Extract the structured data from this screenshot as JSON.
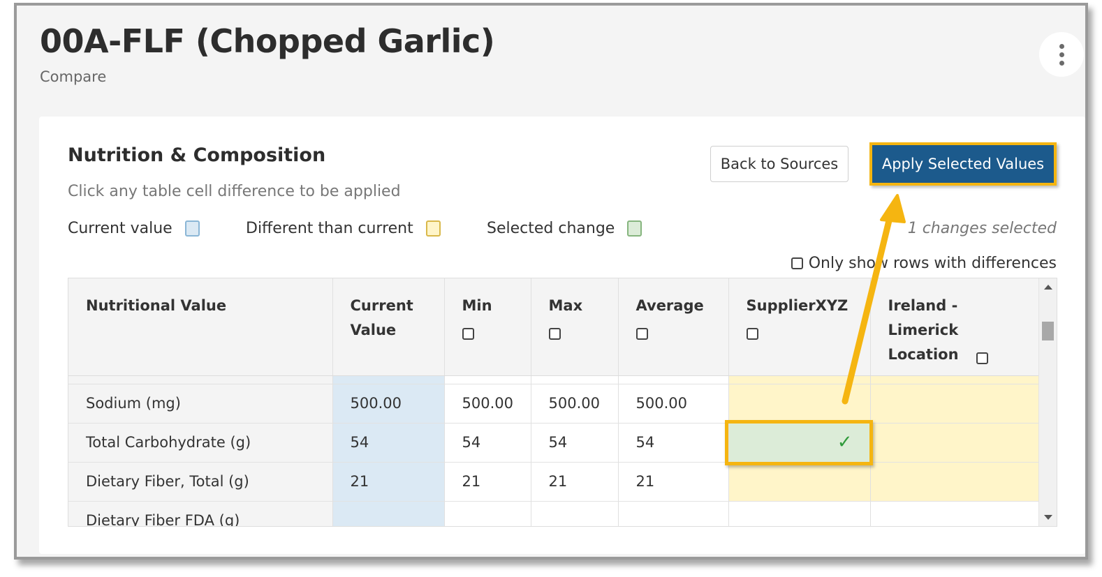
{
  "header": {
    "title": "00A-FLF (Chopped Garlic)",
    "subtitle": "Compare",
    "more_icon": "vertical-ellipsis-icon"
  },
  "section": {
    "title": "Nutrition & Composition",
    "hint": "Click any table cell difference to be applied"
  },
  "legend": {
    "current": "Current value",
    "different": "Different than current",
    "selected": "Selected change"
  },
  "actions": {
    "back_label": "Back to Sources",
    "apply_label": "Apply Selected Values",
    "changes_text": "1 changes selected"
  },
  "filter": {
    "only_diff_label": "Only show rows with differences",
    "checked": false
  },
  "table": {
    "columns": [
      "Nutritional Value",
      "Current Value",
      "Min",
      "Max",
      "Average",
      "SupplierXYZ",
      "Ireland - Limerick Location"
    ],
    "rows": [
      {
        "label": "Sodium (mg)",
        "current": "500.00",
        "min": "500.00",
        "max": "500.00",
        "avg": "500.00",
        "supplier": "",
        "ireland": ""
      },
      {
        "label": "Total Carbohydrate (g)",
        "current": "54",
        "min": "54",
        "max": "54",
        "avg": "54",
        "supplier": "✓",
        "ireland": ""
      },
      {
        "label": "Dietary Fiber, Total (g)",
        "current": "21",
        "min": "21",
        "max": "21",
        "avg": "21",
        "supplier": "",
        "ireland": ""
      },
      {
        "label": "Dietary Fiber FDA (g)",
        "current": "",
        "min": "",
        "max": "",
        "avg": "",
        "supplier": "",
        "ireland": ""
      }
    ]
  },
  "colors": {
    "current_value": "#dbe9f4",
    "different": "#fff5c9",
    "selected": "#dcecd8",
    "apply_button": "#1c5a8c",
    "highlight": "#f5b511"
  }
}
